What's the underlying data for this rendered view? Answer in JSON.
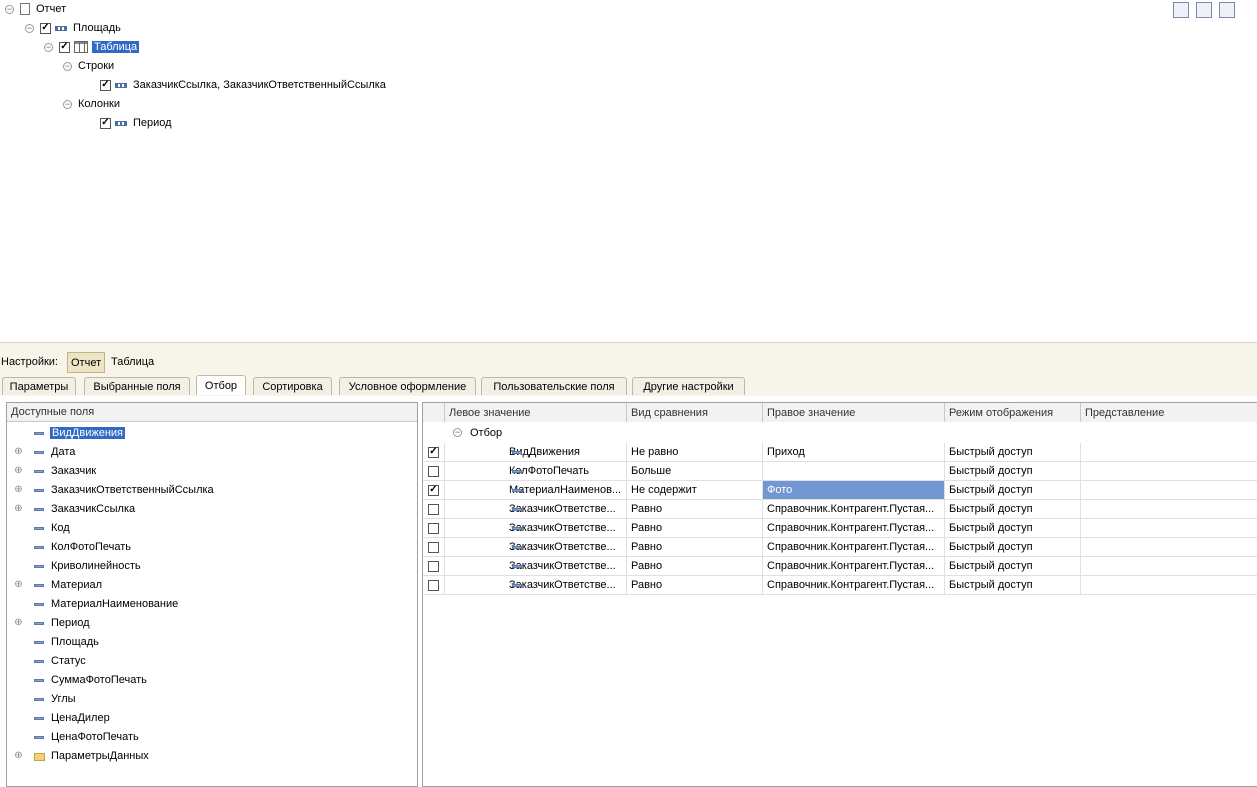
{
  "structure_tree": {
    "root": "Отчет",
    "area": "Площадь",
    "table": "Таблица",
    "rows_label": "Строки",
    "rows_value": "ЗаказчикСсылка, ЗаказчикОтветственныйСсылка",
    "columns_label": "Колонки",
    "columns_value": "Период"
  },
  "settings_bar": {
    "label": "Настройки:",
    "btn_report": "Отчет",
    "btn_table": "Таблица"
  },
  "tabs": [
    {
      "label": "Параметры"
    },
    {
      "label": "Выбранные поля"
    },
    {
      "label": "Отбор"
    },
    {
      "label": "Сортировка"
    },
    {
      "label": "Условное оформление"
    },
    {
      "label": "Пользовательские поля"
    },
    {
      "label": "Другие настройки"
    }
  ],
  "available_fields": {
    "header": "Доступные поля",
    "items": [
      {
        "label": "ВидДвижения"
      },
      {
        "label": "Дата"
      },
      {
        "label": "Заказчик"
      },
      {
        "label": "ЗаказчикОтветственныйСсылка"
      },
      {
        "label": "ЗаказчикСсылка"
      },
      {
        "label": "Код"
      },
      {
        "label": "КолФотоПечать"
      },
      {
        "label": "Криволинейность"
      },
      {
        "label": "Материал"
      },
      {
        "label": "МатериалНаименование"
      },
      {
        "label": "Период"
      },
      {
        "label": "Площадь"
      },
      {
        "label": "Статус"
      },
      {
        "label": "СуммаФотоПечать"
      },
      {
        "label": "Углы"
      },
      {
        "label": "ЦенаДилер"
      },
      {
        "label": "ЦенаФотоПечать"
      },
      {
        "label": "ПараметрыДанных"
      }
    ]
  },
  "filter_table": {
    "columns": {
      "left": "Левое значение",
      "comparison": "Вид сравнения",
      "right": "Правое значение",
      "mode": "Режим отображения",
      "presentation": "Представление"
    },
    "group": "Отбор",
    "rows": [
      {
        "left": "ВидДвижения",
        "comparison": "Не равно",
        "right": "Приход",
        "mode": "Быстрый доступ",
        "presentation": ""
      },
      {
        "left": "КолФотоПечать",
        "comparison": "Больше",
        "right": "",
        "mode": "Быстрый доступ",
        "presentation": ""
      },
      {
        "left": "МатериалНаименов...",
        "comparison": "Не содержит",
        "right": "Фото",
        "mode": "Быстрый доступ",
        "presentation": ""
      },
      {
        "left": "ЗаказчикОтветстве...",
        "comparison": "Равно",
        "right": "Справочник.Контрагент.Пустая...",
        "mode": "Быстрый доступ",
        "presentation": ""
      },
      {
        "left": "ЗаказчикОтветстве...",
        "comparison": "Равно",
        "right": "Справочник.Контрагент.Пустая...",
        "mode": "Быстрый доступ",
        "presentation": ""
      },
      {
        "left": "ЗаказчикОтветстве...",
        "comparison": "Равно",
        "right": "Справочник.Контрагент.Пустая...",
        "mode": "Быстрый доступ",
        "presentation": ""
      },
      {
        "left": "ЗаказчикОтветстве...",
        "comparison": "Равно",
        "right": "Справочник.Контрагент.Пустая...",
        "mode": "Быстрый доступ",
        "presentation": ""
      },
      {
        "left": "ЗаказчикОтветстве...",
        "comparison": "Равно",
        "right": "Справочник.Контрагент.Пустая...",
        "mode": "Быстрый доступ",
        "presentation": ""
      }
    ]
  }
}
